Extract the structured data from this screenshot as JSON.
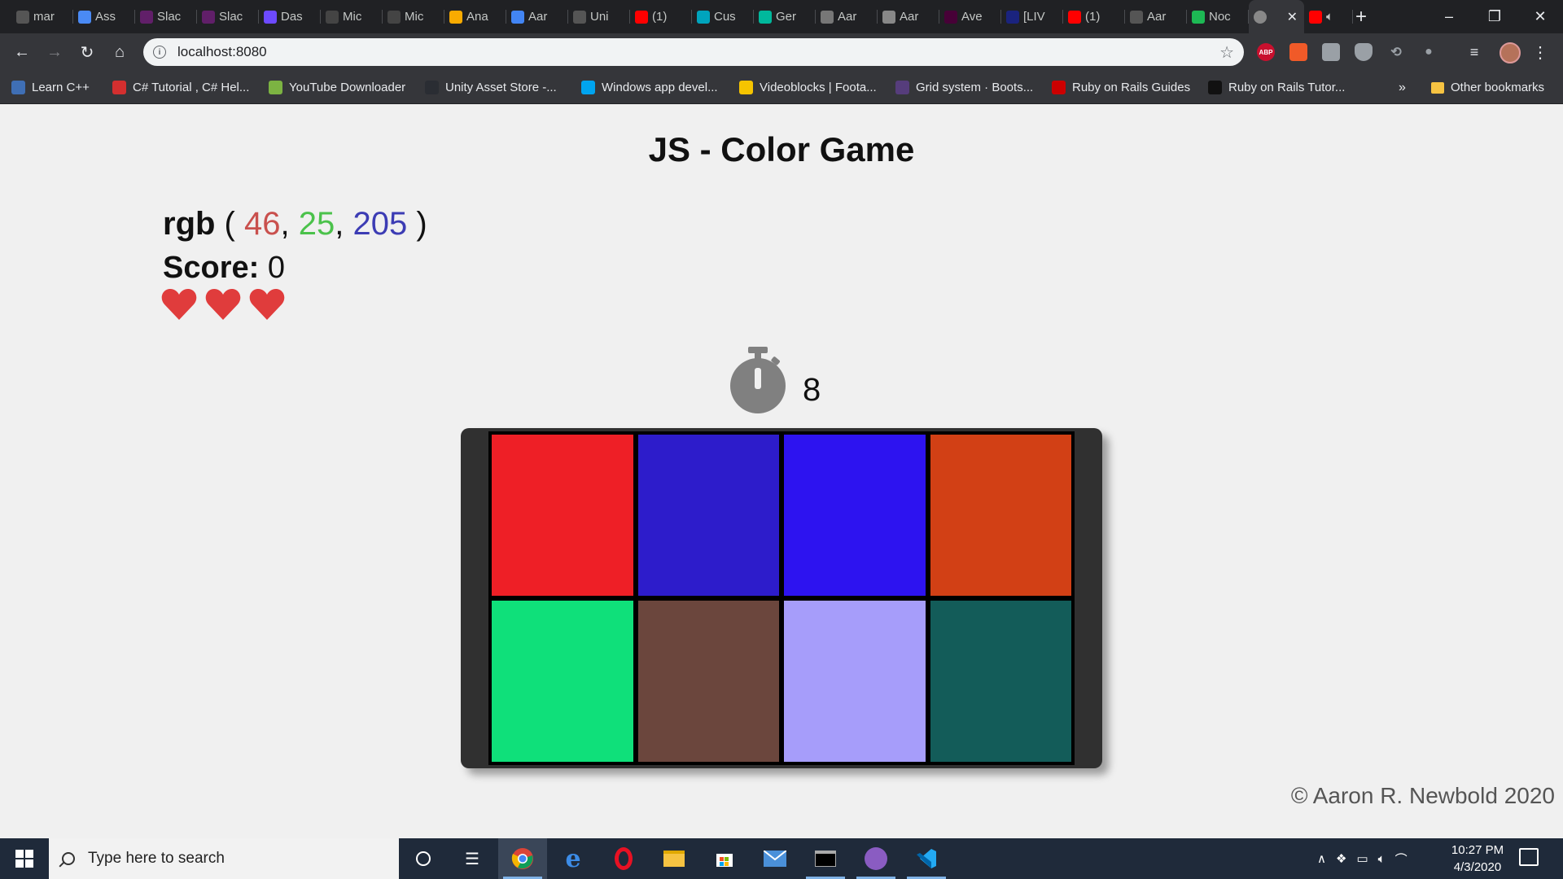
{
  "browser": {
    "tabs": [
      {
        "label": "mar",
        "icon": "github-icon",
        "color": "#555555"
      },
      {
        "label": "Ass",
        "icon": "hexagon-icon",
        "color": "#4a8af4"
      },
      {
        "label": "Slac",
        "icon": "slack-icon",
        "color": "#611f69"
      },
      {
        "label": "Slac",
        "icon": "slack-icon",
        "color": "#611f69"
      },
      {
        "label": "Das",
        "icon": "mural-icon",
        "color": "#6d4aff"
      },
      {
        "label": "Mic",
        "icon": "mural-icon",
        "color": "#444444"
      },
      {
        "label": "Mic",
        "icon": "mural-icon",
        "color": "#444444"
      },
      {
        "label": "Ana",
        "icon": "analytics-icon",
        "color": "#f9ab00"
      },
      {
        "label": "Aar",
        "icon": "docs-icon",
        "color": "#4285f4"
      },
      {
        "label": "Uni",
        "icon": "vscode-icon",
        "color": "#555555"
      },
      {
        "label": "(1)",
        "icon": "youtube-icon",
        "color": "#ff0000"
      },
      {
        "label": "Cus",
        "icon": "diamond-icon",
        "color": "#00a4bd"
      },
      {
        "label": "Ger",
        "icon": "diamond-icon",
        "color": "#00b89c"
      },
      {
        "label": "Aar",
        "icon": "globe-icon",
        "color": "#777777"
      },
      {
        "label": "Aar",
        "icon": "hand-icon",
        "color": "#888888"
      },
      {
        "label": "Ave",
        "icon": "xd-icon",
        "color": "#470137"
      },
      {
        "label": "[LIV",
        "icon": "dollar-icon",
        "color": "#1a237e"
      },
      {
        "label": "(1)",
        "icon": "youtube-icon",
        "color": "#ff0000"
      },
      {
        "label": "Aar",
        "icon": "github-icon",
        "color": "#555555"
      },
      {
        "label": "Noc",
        "icon": "power-icon",
        "color": "#1db954"
      }
    ],
    "active_tab": {
      "icon": "globe-icon",
      "close": "✕"
    },
    "url": "localhost:8080",
    "bookmarks": [
      {
        "label": "Learn C++",
        "icon": "cpp-icon",
        "color": "#3f6fb5"
      },
      {
        "label": "C# Tutorial , C# Hel...",
        "icon": "n-icon",
        "color": "#d32f2f"
      },
      {
        "label": "YouTube Downloader",
        "icon": "download-arrow-icon",
        "color": "#7cb342"
      },
      {
        "label": "Unity Asset Store -...",
        "icon": "unity-icon",
        "color": "#2a2d33"
      },
      {
        "label": "Windows app devel...",
        "icon": "windows-logo-icon",
        "color": "#00a4ef"
      },
      {
        "label": "Videoblocks | Foota...",
        "icon": "dollar-coin-icon",
        "color": "#f5c400"
      },
      {
        "label": "Grid system · Boots...",
        "icon": "bootstrap-icon",
        "color": "#563d7c"
      },
      {
        "label": "Ruby on Rails Guides",
        "icon": "rails-icon",
        "color": "#cc0000"
      },
      {
        "label": "Ruby on Rails Tutor...",
        "icon": "rails-tutorial-icon",
        "color": "#111111"
      }
    ],
    "other_bookmarks": "Other bookmarks",
    "chevron": "»"
  },
  "game": {
    "title": "JS - Color Game",
    "rgb_label": "rgb",
    "rgb_open": " ( ",
    "rgb_r": "46",
    "rgb_g": "25",
    "rgb_b": "205",
    "rgb_sep": ", ",
    "rgb_close": " )",
    "rgb_colors": {
      "r": "#c9504d",
      "g": "#4bc24b",
      "b": "#3c3cb4"
    },
    "score_label": "Score:",
    "score_value": "0",
    "lives": 3,
    "heart_color": "#e03c3c",
    "timer_value": "8",
    "squares": [
      "#ee1f26",
      "#2d1ccb",
      "#2d13f0",
      "#d24015",
      "#0fe07a",
      "#6b463d",
      "#a69dfa",
      "#135c59"
    ],
    "footer": "© Aaron R. Newbold 2020"
  },
  "taskbar": {
    "search_placeholder": "Type here to search",
    "time": "10:27 PM",
    "date": "4/3/2020"
  }
}
